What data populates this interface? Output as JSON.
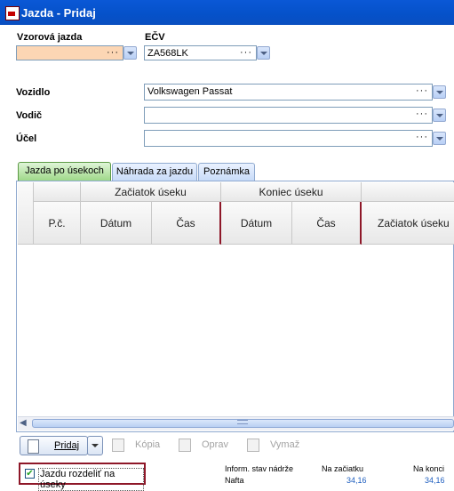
{
  "window": {
    "title": "Jazda - Pridaj"
  },
  "fields": {
    "vzorova_label": "Vzorová jazda",
    "vzorova_value": "",
    "ecv_label": "EČV",
    "ecv_value": "ZA568LK",
    "vozidlo_label": "Vozidlo",
    "vozidlo_value": "Volkswagen Passat",
    "vodic_label": "Vodič",
    "vodic_value": "",
    "ucel_label": "Účel",
    "ucel_value": ""
  },
  "tabs": [
    {
      "label": "Jazda po úsekoch"
    },
    {
      "label": "Náhrada za jazdu"
    },
    {
      "label": "Poznámka"
    }
  ],
  "grid": {
    "group_start": "Začiatok úseku",
    "group_end": "Koniec úseku",
    "col_pc": "P.č.",
    "col_date1": "Dátum",
    "col_time1": "Čas",
    "col_date2": "Dátum",
    "col_time2": "Čas",
    "col_start_point": "Začiatok úseku"
  },
  "toolbar": {
    "pridaj": "Pridaj",
    "kopia": "Kópia",
    "oprav": "Oprav",
    "vymaz": "Vymaž"
  },
  "footer": {
    "split_checkbox_label": "Jazdu rozdeliť na úseky",
    "split_checked": true,
    "tank_label": "Inform. stav nádrže",
    "fuel_label": "Nafta",
    "start_label": "Na začiatku",
    "start_value": "34,16",
    "end_label": "Na konci",
    "end_value": "34,16"
  },
  "colors": {
    "title_bar": "#0551c9",
    "highlight_field": "#fcd6b4",
    "active_tab": "#9fd889",
    "checkbox_frame": "#8e1728",
    "value_blue": "#1f5fbf"
  }
}
